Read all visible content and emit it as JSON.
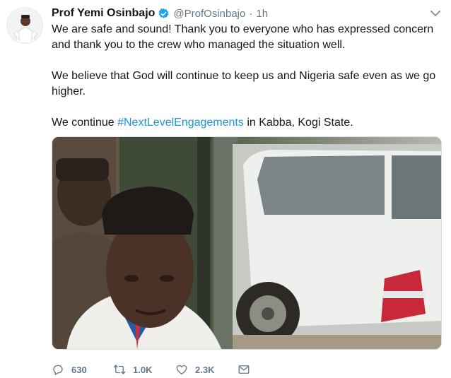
{
  "author": {
    "display_name": "Prof Yemi Osinbajo",
    "handle": "@ProfOsinbajo",
    "separator": "·",
    "time": "1h",
    "verified": true
  },
  "tweet": {
    "paragraph_1": "We are safe and sound! Thank you to everyone who has expressed concern and thank you to the crew who managed the situation well.",
    "paragraph_2": "We believe that God will continue to keep us and Nigeria safe even as we go higher.",
    "paragraph_3_before": "We continue ",
    "paragraph_3_hashtag": "#NextLevelEngagements",
    "paragraph_3_after": " in Kabba, Kogi State."
  },
  "actions": {
    "replies": "630",
    "retweets": "1.0K",
    "likes": "2.3K"
  },
  "icons": {
    "verified": "verified-badge-icon",
    "caret": "chevron-down-icon",
    "reply": "reply-icon",
    "retweet": "retweet-icon",
    "like": "heart-icon",
    "message": "envelope-icon"
  },
  "colors": {
    "link": "#1b95e0",
    "verified": "#1da1f2",
    "secondary_text": "#657786"
  }
}
